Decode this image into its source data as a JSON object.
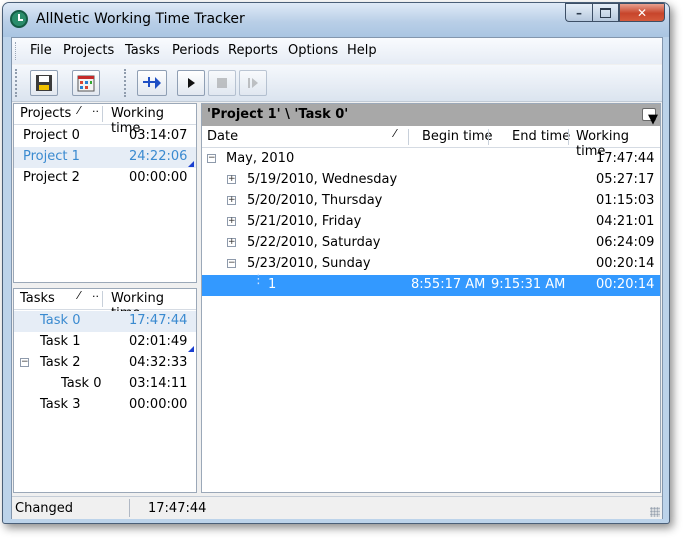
{
  "window": {
    "title": "AllNetic Working Time Tracker"
  },
  "menu": {
    "items": [
      "File",
      "Projects",
      "Tasks",
      "Periods",
      "Reports",
      "Options",
      "Help"
    ]
  },
  "toolbar": {
    "buttons": [
      "save-icon",
      "report-icon",
      "add-period-icon",
      "play-icon",
      "stop-icon",
      "pause-icon"
    ]
  },
  "projects": {
    "headers": [
      "Projects",
      "Working time"
    ],
    "rows": [
      {
        "name": "Project 0",
        "time": "03:14:07"
      },
      {
        "name": "Project 1",
        "time": "24:22:06"
      },
      {
        "name": "Project 2",
        "time": "00:00:00"
      }
    ]
  },
  "tasks": {
    "headers": [
      "Tasks",
      "Working time"
    ],
    "rows": [
      {
        "name": "Task 0",
        "time": "17:47:44"
      },
      {
        "name": "Task 1",
        "time": "02:01:49"
      },
      {
        "name": "Task 2",
        "time": "04:32:33",
        "expander": "−"
      },
      {
        "name": "Task 0",
        "time": "03:14:11"
      },
      {
        "name": "Task 3",
        "time": "00:00:00"
      }
    ]
  },
  "detail": {
    "path": "'Project 1' \\ 'Task 0'",
    "headers": [
      "Date",
      "Begin time",
      "End time",
      "Working time"
    ],
    "rows": [
      {
        "expander": "−",
        "date": "May, 2010",
        "begin": "",
        "end": "",
        "time": "17:47:44"
      },
      {
        "expander": "+",
        "date": "5/19/2010, Wednesday",
        "begin": "",
        "end": "",
        "time": "05:27:17"
      },
      {
        "expander": "+",
        "date": "5/20/2010, Thursday",
        "begin": "",
        "end": "",
        "time": "01:15:03"
      },
      {
        "expander": "+",
        "date": "5/21/2010, Friday",
        "begin": "",
        "end": "",
        "time": "04:21:01"
      },
      {
        "expander": "+",
        "date": "5/22/2010, Saturday",
        "begin": "",
        "end": "",
        "time": "06:24:09"
      },
      {
        "expander": "−",
        "date": "5/23/2010, Sunday",
        "begin": "",
        "end": "",
        "time": "00:20:14"
      },
      {
        "expander": "",
        "date": "1",
        "begin": "8:55:17 AM",
        "end": "9:15:31 AM",
        "time": "00:20:14"
      }
    ]
  },
  "status": {
    "state": "Changed",
    "time": "17:47:44"
  },
  "colors": {
    "selection": "#3399ff",
    "selected_text": "#3a8ad0",
    "path_bar": "#a8a8a8"
  }
}
